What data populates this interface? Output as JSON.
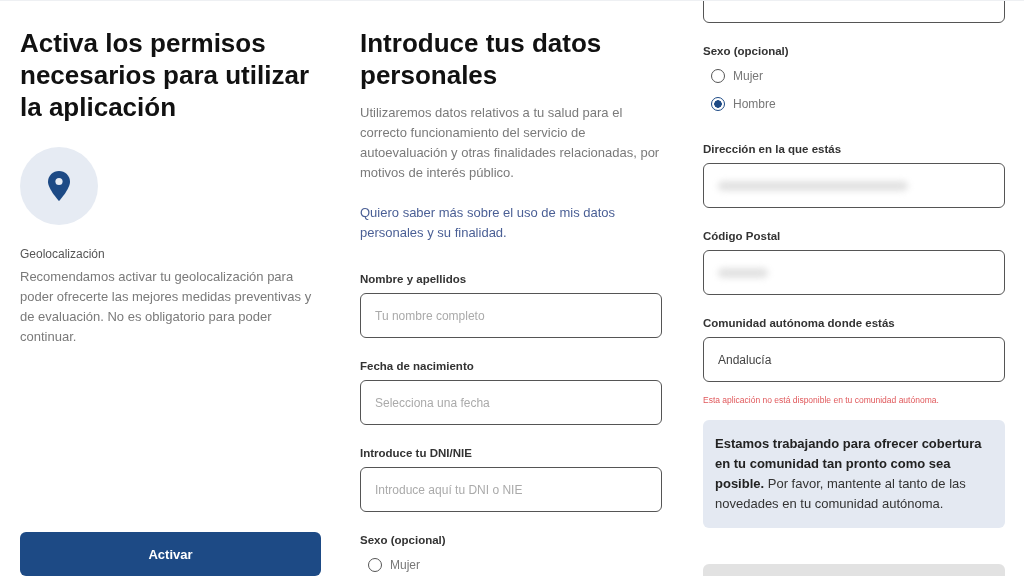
{
  "permissions_screen": {
    "title": "Activa los permisos necesarios para utilizar la aplicación",
    "permission_name": "Geolocalización",
    "permission_description": "Recomendamos activar tu geolocalización para poder ofrecerte las mejores medidas preventivas y de evaluación. No es obligatorio para poder continuar.",
    "button": "Activar"
  },
  "personal_data_screen": {
    "title": "Introduce tus datos personales",
    "intro": "Utilizaremos datos relativos a tu salud para el correcto funcionamiento del servicio de autoevaluación y otras finalidades relacionadas, por motivos de interés público.",
    "link": "Quiero saber más sobre el uso de mis datos personales y su finalidad.",
    "fields": [
      {
        "label": "Nombre y apellidos",
        "placeholder": "Tu nombre completo"
      },
      {
        "label": "Fecha de nacimiento",
        "placeholder": "Selecciona una fecha"
      },
      {
        "label": "Introduce tu DNI/NIE",
        "placeholder": "Introduce aquí tu DNI o NIE"
      }
    ],
    "sex_label": "Sexo (opcional)",
    "sex_options": [
      {
        "label": "Mujer",
        "selected": false
      }
    ]
  },
  "personal_data_screen_continued": {
    "sex_label": "Sexo (opcional)",
    "sex_options": [
      {
        "label": "Mujer",
        "selected": false
      },
      {
        "label": "Hombre",
        "selected": true
      }
    ],
    "fields": [
      {
        "label": "Dirección en la que estás",
        "blurred": true
      },
      {
        "label": "Código Postal",
        "blurred": true
      },
      {
        "label": "Comunidad autónoma donde estás",
        "value": "Andalucía"
      }
    ],
    "error": "Esta aplicación no está disponible en tu comunidad autónoma.",
    "notice": "**Estamos trabajando para ofrecer cobertura en tu comunidad tan pronto como sea posible.** Por favor, mantente al tanto de las novedades en tu comunidad autónoma."
  }
}
